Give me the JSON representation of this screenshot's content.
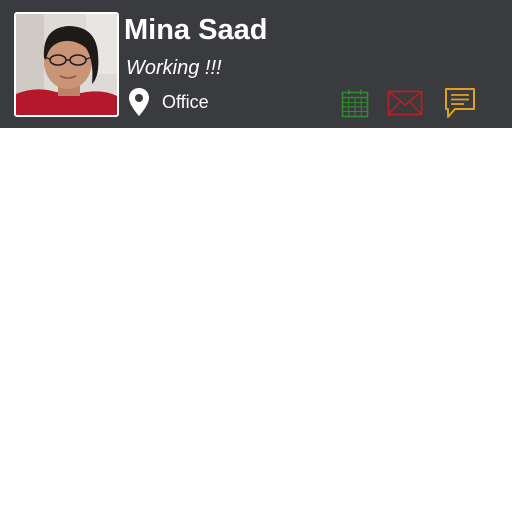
{
  "profile": {
    "name": "Mina Saad",
    "status": "Working !!!",
    "location": "Office",
    "avatar": "user-photo"
  },
  "actions": [
    {
      "icon": "calendar-icon",
      "color": "#2e8b2e"
    },
    {
      "icon": "mail-icon",
      "color": "#b22222"
    },
    {
      "icon": "message-icon",
      "color": "#e0a020"
    }
  ],
  "colors": {
    "header_bg": "#3a3b3e",
    "text": "#ffffff",
    "background": "#ffffff"
  }
}
